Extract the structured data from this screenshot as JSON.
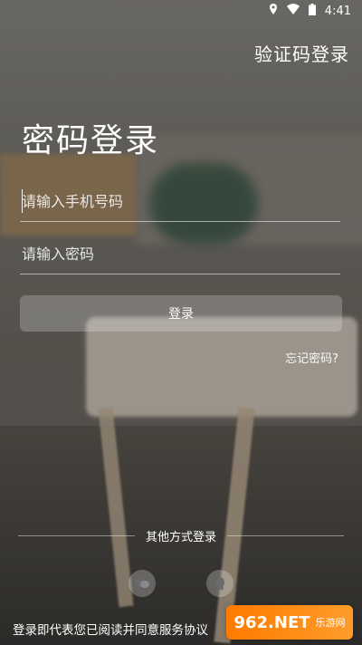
{
  "status_bar": {
    "time": "4:41",
    "icons": [
      "location-icon",
      "wifi-icon",
      "battery-icon"
    ]
  },
  "header": {
    "switch_login_label": "验证码登录"
  },
  "page_title": "密码登录",
  "form": {
    "phone_placeholder": "请输入手机号码",
    "password_placeholder": "请输入密码",
    "login_button": "登录",
    "forgot_password": "忘记密码?"
  },
  "other_methods": {
    "label": "其他方式登录",
    "icons": [
      "wechat-icon",
      "qq-icon"
    ]
  },
  "agreement": {
    "text": "登录即代表您已阅读并同意",
    "link_text": "服务协议"
  },
  "watermark": {
    "brand": "962.NET",
    "sub": "乐游网"
  },
  "colors": {
    "overlay": "#00000040",
    "button_bg": "#FFFFFF38",
    "watermark": "#FF7A00"
  }
}
